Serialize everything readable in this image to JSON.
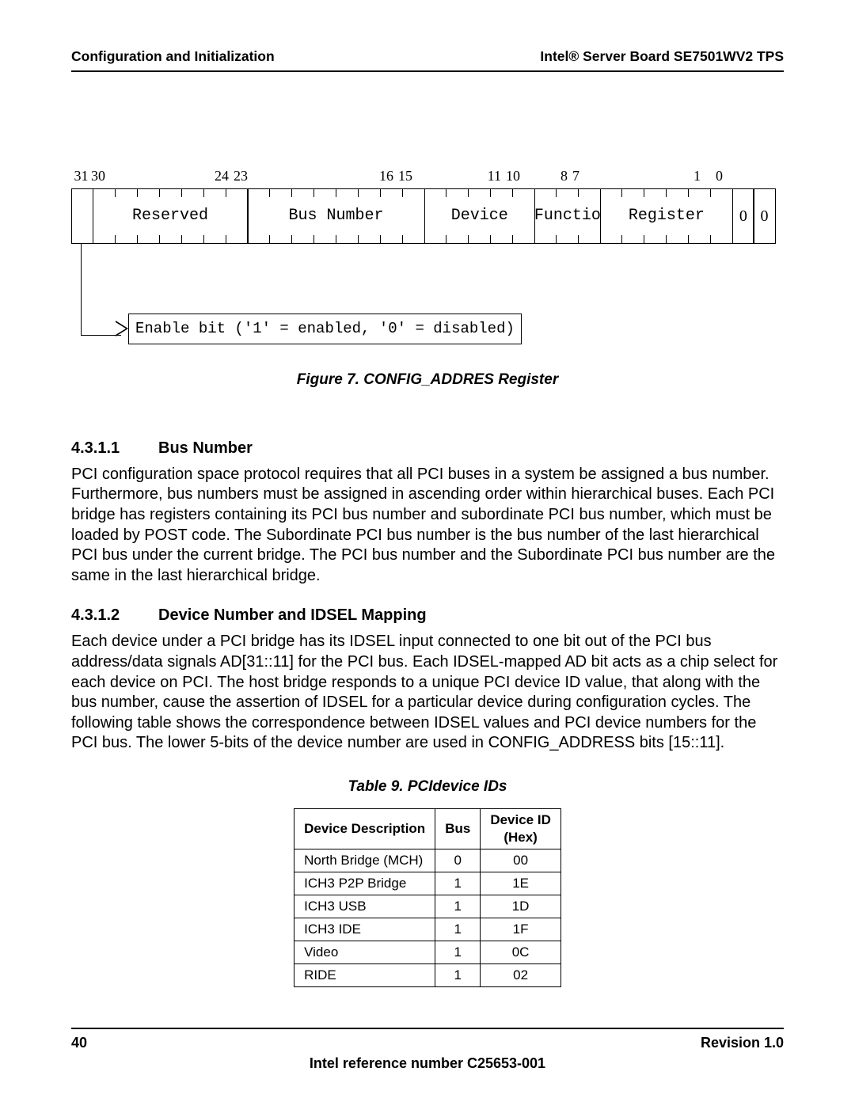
{
  "header": {
    "left": "Configuration and Initialization",
    "right": "Intel® Server Board SE7501WV2 TPS"
  },
  "register": {
    "bit_ranges": [
      "31",
      "30",
      "24",
      "23",
      "16",
      "15",
      "11",
      "10",
      "8",
      "7",
      "1",
      "0"
    ],
    "fields": [
      {
        "label": "",
        "bits": 1,
        "show_ticks": false
      },
      {
        "label": "Reserved",
        "bits": 7,
        "show_ticks": true
      },
      {
        "label": "Bus Number",
        "bits": 8,
        "show_ticks": true
      },
      {
        "label": "Device",
        "bits": 5,
        "show_ticks": true
      },
      {
        "label": "Functio",
        "bits": 3,
        "show_ticks": true
      },
      {
        "label": "Register",
        "bits": 6,
        "show_ticks": true
      },
      {
        "label": "0",
        "bits": 1,
        "show_ticks": false,
        "serif": true
      },
      {
        "label": "0",
        "bits": 1,
        "show_ticks": false,
        "serif": true
      }
    ],
    "callout": "Enable bit ('1' = enabled, '0' = disabled)",
    "caption": "Figure 7. CONFIG_ADDRES Register"
  },
  "sections": [
    {
      "num": "4.3.1.1",
      "title": "Bus Number",
      "body": "PCI configuration space protocol requires that all PCI buses in a system be assigned a bus number. Furthermore, bus numbers must be assigned in ascending order within hierarchical buses. Each PCI bridge has registers containing its PCI bus number and subordinate PCI bus number, which must be loaded by POST code. The Subordinate PCI bus number is the bus number of the last hierarchical PCI bus under the current bridge. The PCI bus number and the Subordinate PCI bus number are the same in the last hierarchical bridge."
    },
    {
      "num": "4.3.1.2",
      "title": "Device Number and IDSEL Mapping",
      "body": "Each device under a PCI bridge has its IDSEL input connected to one bit out of the PCI bus address/data signals AD[31::11] for the PCI bus. Each IDSEL-mapped AD bit acts as a chip select for each device on PCI. The host bridge responds to a unique PCI device ID value, that along with the bus number, cause the assertion of IDSEL for a particular device during configuration cycles. The following table shows the correspondence between IDSEL values and PCI device numbers for the PCI bus. The lower 5-bits of the device number are used in CONFIG_ADDRESS bits [15::11]."
    }
  ],
  "table": {
    "caption": "Table 9. PCIdevice IDs",
    "headers": [
      "Device Description",
      "Bus",
      "Device ID (Hex)"
    ],
    "rows": [
      [
        "North Bridge (MCH)",
        "0",
        "00"
      ],
      [
        "ICH3 P2P Bridge",
        "1",
        "1E"
      ],
      [
        "ICH3 USB",
        "1",
        "1D"
      ],
      [
        "ICH3 IDE",
        "1",
        "1F"
      ],
      [
        "Video",
        "1",
        "0C"
      ],
      [
        "RIDE",
        "1",
        "02"
      ]
    ]
  },
  "footer": {
    "page": "40",
    "revision": "Revision 1.0",
    "ref": "Intel reference number C25653-001"
  }
}
